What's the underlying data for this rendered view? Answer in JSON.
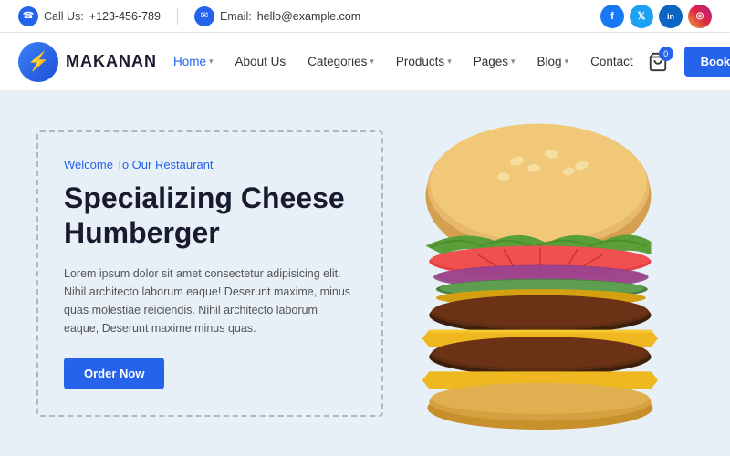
{
  "topbar": {
    "phone_icon": "📞",
    "phone_label": "Call Us:",
    "phone_number": "+123-456-789",
    "email_icon": "✉",
    "email_label": "Email:",
    "email_address": "hello@example.com",
    "social": [
      {
        "name": "facebook",
        "letter": "f",
        "class": "social-fb"
      },
      {
        "name": "twitter",
        "letter": "t",
        "class": "social-tw"
      },
      {
        "name": "linkedin",
        "letter": "in",
        "class": "social-li"
      },
      {
        "name": "instagram",
        "letter": "ig",
        "class": "social-ig"
      }
    ]
  },
  "navbar": {
    "logo_letter": "⚡",
    "logo_text": "MAKANAN",
    "nav_items": [
      {
        "label": "Home",
        "has_chevron": true,
        "active": true
      },
      {
        "label": "About Us",
        "has_chevron": false,
        "active": false
      },
      {
        "label": "Categories",
        "has_chevron": true,
        "active": false
      },
      {
        "label": "Products",
        "has_chevron": true,
        "active": false
      },
      {
        "label": "Pages",
        "has_chevron": true,
        "active": false
      },
      {
        "label": "Blog",
        "has_chevron": true,
        "active": false
      },
      {
        "label": "Contact",
        "has_chevron": false,
        "active": false
      }
    ],
    "cart_count": "0",
    "book_btn": "Book A Table"
  },
  "hero": {
    "welcome": "Welcome To Our Restaurant",
    "title": "Specializing Cheese Humberger",
    "description": "Lorem ipsum dolor sit amet consectetur adipisicing elit. Nihil architecto laborum eaque! Deserunt maxime, minus quas molestiae reiciendis. Nihil architecto laborum eaque, Deserunt maxime minus quas.",
    "order_btn": "Order Now"
  }
}
